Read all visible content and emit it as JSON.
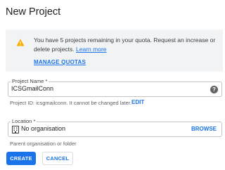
{
  "dialog": {
    "title": "New Project"
  },
  "quota": {
    "message": "You have 5 projects remaining in your quota. Request an increase or delete projects.",
    "learn_more": "Learn more",
    "manage_quotas": "MANAGE QUOTAS",
    "icon": "warning-icon",
    "icon_color": "#f9ab00"
  },
  "project_name": {
    "label": "Project Name *",
    "value": "ICSGmailConn",
    "help_icon": "?"
  },
  "project_id": {
    "text": "Project ID: icsgmailconn. It cannot be changed later.",
    "edit": "EDIT"
  },
  "location": {
    "label": "Location *",
    "value": "No organisation",
    "browse": "BROWSE",
    "hint": "Parent organisation or folder",
    "icon": "organisation-icon"
  },
  "actions": {
    "create": "CREATE",
    "cancel": "CANCEL"
  },
  "colors": {
    "accent": "#1a73e8",
    "quota_bg": "#f1f3f4"
  }
}
